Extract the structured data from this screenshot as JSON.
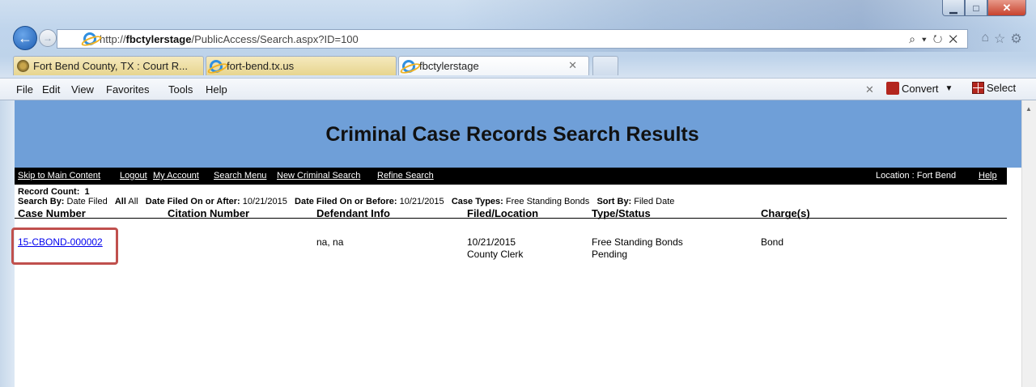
{
  "browser": {
    "address_prefix": "http://",
    "address_host": "fbctylerstage",
    "address_path": "/PublicAccess/Search.aspx?ID=100",
    "address_tools": "⌕ ▾ ↻ ✕",
    "tabs": [
      {
        "label": "Fort Bend County, TX : Court R..."
      },
      {
        "label": "fort-bend.tx.us"
      },
      {
        "label": "fbctylerstage"
      }
    ],
    "menu": {
      "file": "File",
      "edit": "Edit",
      "view": "View",
      "favorites": "Favorites",
      "tools": "Tools",
      "help": "Help"
    },
    "toolbar": {
      "convert_label": "Convert",
      "select_label": "Select"
    }
  },
  "page": {
    "title": "Criminal Case Records Search Results",
    "nav": {
      "skip": "Skip to Main Content",
      "logout": "Logout",
      "account": "My Account",
      "search_menu": "Search Menu",
      "new_criminal": "New Criminal Search",
      "refine": "Refine Search",
      "location": "Location : Fort Bend",
      "help": "Help"
    },
    "record_count_label": "Record Count:",
    "record_count": "1",
    "criteria": {
      "search_by_label": "Search By:",
      "search_by": "Date Filed",
      "all_label": "All",
      "all_value": "All",
      "filed_after_label": "Date Filed On or After:",
      "filed_after": "10/21/2015",
      "filed_before_label": "Date Filed On or Before:",
      "filed_before": "10/21/2015",
      "case_types_label": "Case Types:",
      "case_types": "Free Standing Bonds",
      "sort_by_label": "Sort By:",
      "sort_by": "Filed Date"
    },
    "columns": {
      "case_number": "Case Number",
      "citation_number": "Citation Number",
      "defendant_info": "Defendant Info",
      "filed_location": "Filed/Location",
      "type_status": "Type/Status",
      "charges": "Charge(s)"
    },
    "rows": [
      {
        "case_number": "15-CBOND-000002",
        "citation_number": "",
        "defendant": "na, na",
        "filed_date": "10/21/2015",
        "location": "County Clerk",
        "type": "Free Standing Bonds",
        "status": "Pending",
        "charge": "Bond"
      }
    ],
    "highlight_color": "#c0504d",
    "banner_color": "#6f9fd8"
  }
}
